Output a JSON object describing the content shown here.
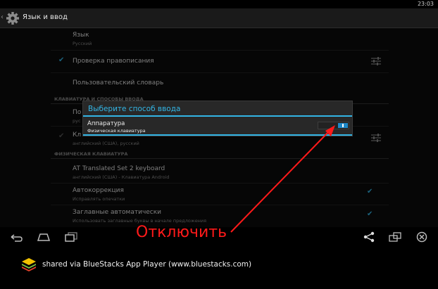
{
  "status_bar": {
    "time": "23:03"
  },
  "action_bar": {
    "icon": "gear-icon",
    "title": "Язык и ввод"
  },
  "settings": {
    "items_top": [
      {
        "title": "Язык",
        "summary": "Русский"
      },
      {
        "title": "Проверка правописания",
        "checked": true
      },
      {
        "title": "Пользовательский словарь"
      }
    ],
    "section_keyboards": "КЛАВИАТУРА И СПОСОБЫ ВВОДА",
    "keyboards": [
      {
        "title": "По",
        "summary": "рус"
      },
      {
        "title": "Кл",
        "summary": "английский (США), русский"
      }
    ],
    "section_physical": "ФИЗИЧЕСКАЯ КЛАВИАТУРА",
    "physical": [
      {
        "title": "AT Translated Set 2 keyboard",
        "summary": "английский (США) - Клавиатура Android"
      },
      {
        "title": "Автокоррекция",
        "summary": "Исправлять опечатки",
        "checked": true
      },
      {
        "title": "Заглавные автоматически",
        "summary": "Использовать заглавные буквы в начале предложения",
        "checked": true
      }
    ]
  },
  "dialog": {
    "title": "Выберите способ ввода",
    "option_title": "Аппаратура",
    "option_summary": "Физическая клавиатура",
    "toggle_on": true
  },
  "annotation": {
    "text": "Отключить",
    "color": "#ff1a1a"
  },
  "nav_bar": {
    "buttons": [
      "back-icon",
      "home-icon",
      "recent-apps-icon",
      "share-icon",
      "rotate-icon",
      "close-icon"
    ]
  },
  "footer": {
    "text": "shared via BlueStacks App Player (www.bluestacks.com)"
  },
  "colors": {
    "accent": "#33b5e5"
  }
}
